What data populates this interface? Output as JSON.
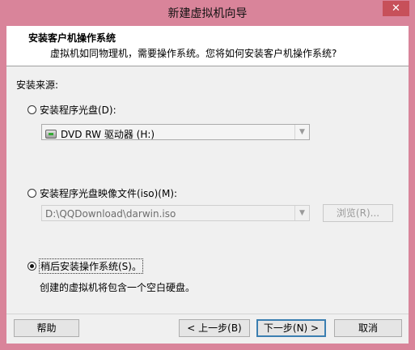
{
  "window": {
    "title": "新建虚拟机向导",
    "close_label": "✕"
  },
  "header": {
    "title": "安装客户机操作系统",
    "subtitle": "虚拟机如同物理机，需要操作系统。您将如何安装客户机操作系统?"
  },
  "source": {
    "label": "安装来源:",
    "options": [
      {
        "label": "安装程序光盘(D):",
        "selected": false
      },
      {
        "label": "安装程序光盘映像文件(iso)(M):",
        "selected": false
      },
      {
        "label": "稍后安装操作系统(S)。",
        "selected": true
      }
    ],
    "disc_drive_value": "DVD RW 驱动器 (H:)",
    "iso_path_value": "D:\\QQDownload\\darwin.iso",
    "browse_label": "浏览(R)...",
    "later_description": "创建的虚拟机将包含一个空白硬盘。"
  },
  "footer": {
    "help_label": "帮助",
    "back_label": "< 上一步(B)",
    "next_label": "下一步(N) >",
    "cancel_label": "取消"
  },
  "icons": {
    "close": "close-icon",
    "disc_drive": "dvd-drive-icon",
    "dropdown": "chevron-down-icon"
  },
  "colors": {
    "titlebar": "#d9849a",
    "close_button": "#c7505a",
    "default_button_border": "#3c7fb1"
  }
}
